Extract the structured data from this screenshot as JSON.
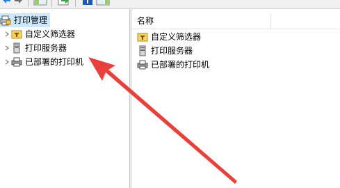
{
  "toolbar": {
    "buttons": [
      {
        "icon": "back-arrow-icon"
      },
      {
        "icon": "forward-arrow-icon"
      },
      {
        "icon": "show-hide-tree-icon"
      },
      {
        "icon": "export-list-icon"
      },
      {
        "icon": "help-icon"
      },
      {
        "icon": "show-hide-action-pane-icon"
      }
    ]
  },
  "tree": {
    "root": {
      "label": "打印管理",
      "icon": "print-management-icon",
      "selected": true
    },
    "items": [
      {
        "label": "自定义筛选器",
        "icon": "filter-folder-icon"
      },
      {
        "label": "打印服务器",
        "icon": "server-icon"
      },
      {
        "label": "已部署的打印机",
        "icon": "printer-icon"
      }
    ]
  },
  "list": {
    "column_header": "名称",
    "items": [
      {
        "label": "自定义筛选器",
        "icon": "filter-folder-icon"
      },
      {
        "label": "打印服务器",
        "icon": "server-icon"
      },
      {
        "label": "已部署的打印机",
        "icon": "printer-icon"
      }
    ]
  },
  "colors": {
    "selection": "#cce8ff",
    "arrow": "#e8403a",
    "toolbar_bg": "#f0f0f0"
  }
}
